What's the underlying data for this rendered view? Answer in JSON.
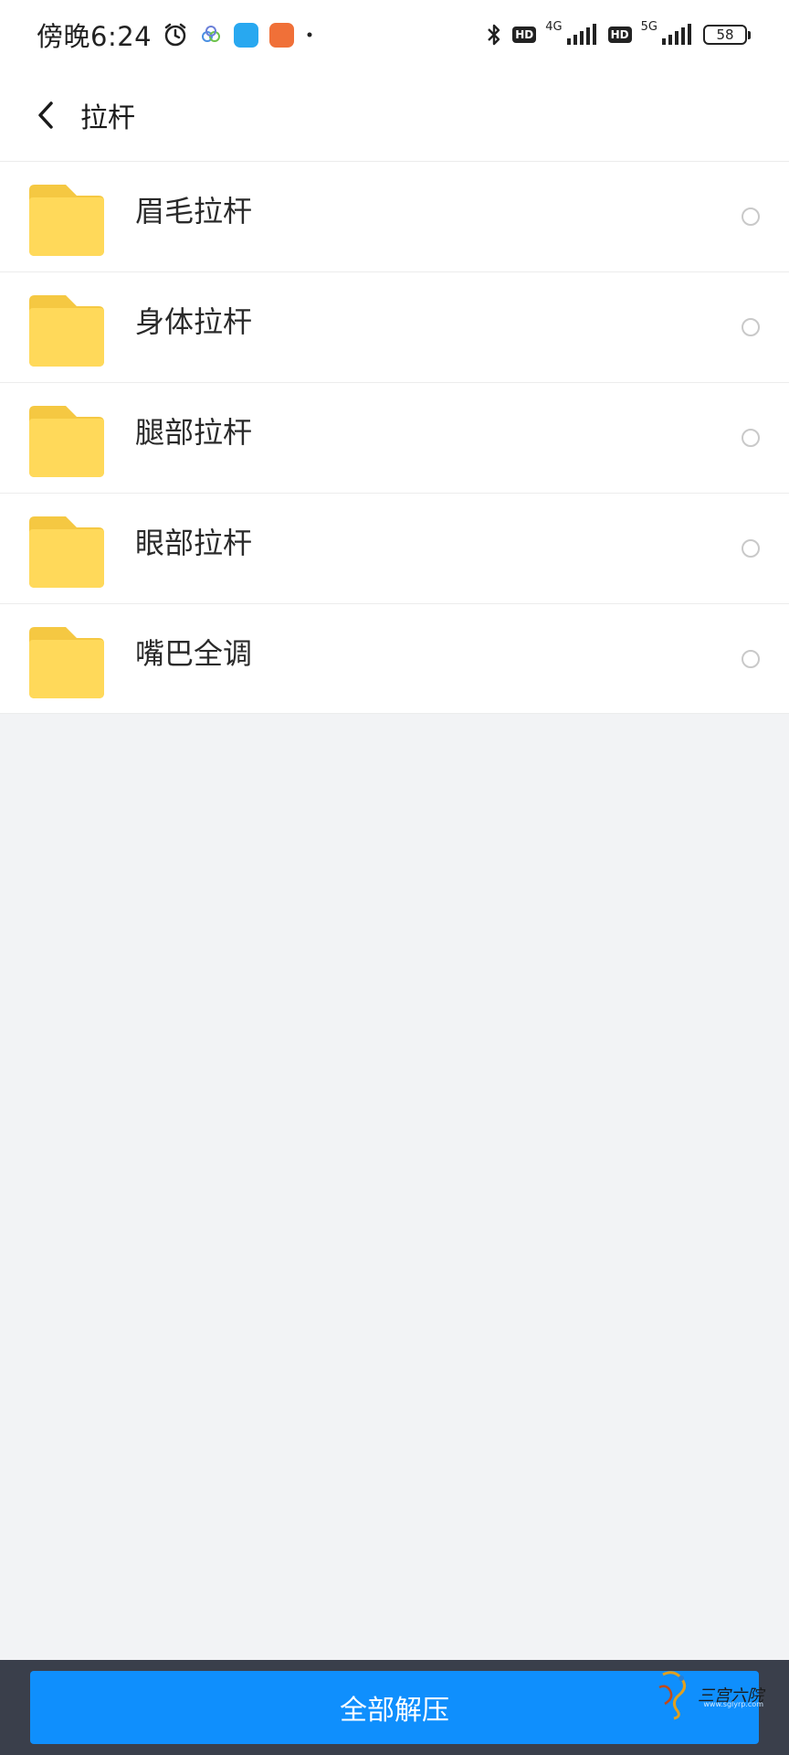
{
  "status_bar": {
    "time": "傍晚6:24",
    "net1": "4G",
    "net2": "5G",
    "hd": "HD",
    "battery": "58"
  },
  "header": {
    "title": "拉杆"
  },
  "folders": [
    {
      "name": "眉毛拉杆"
    },
    {
      "name": "身体拉杆"
    },
    {
      "name": "腿部拉杆"
    },
    {
      "name": "眼部拉杆"
    },
    {
      "name": "嘴巴全调"
    }
  ],
  "bottom": {
    "extract_all_label": "全部解压",
    "watermark_logo": "三宫六院",
    "watermark_url": "www.sglyrp.com"
  },
  "colors": {
    "accent": "#0f8ffd",
    "folder": "#ffd54f",
    "bottom_bar": "#3a3f4b",
    "background": "#f2f3f5"
  },
  "icons": [
    "back-chevron-icon",
    "alarm-clock-icon",
    "bluetooth-icon",
    "signal-icon",
    "folder-icon"
  ]
}
